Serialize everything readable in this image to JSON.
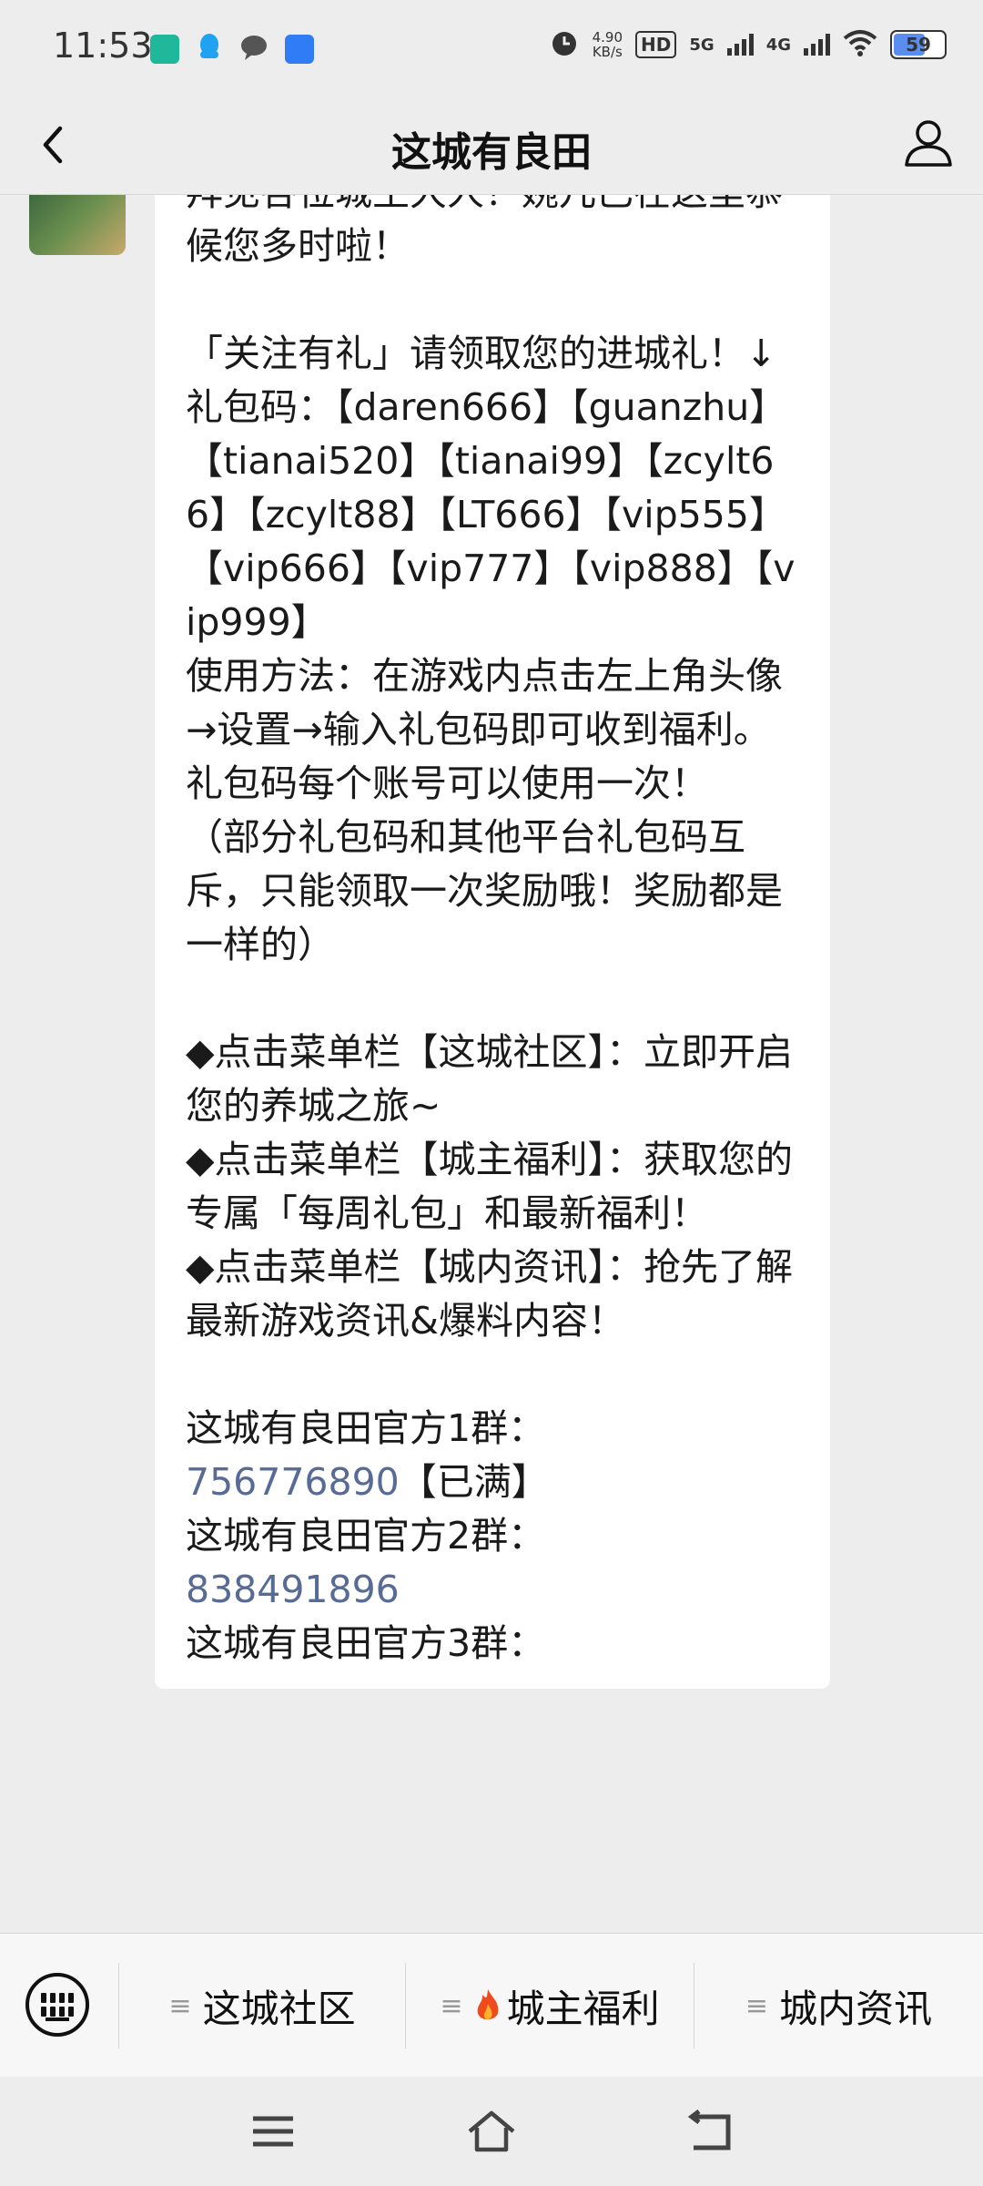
{
  "status": {
    "time": "11:53",
    "speed_value": "4.90",
    "speed_unit": "KB/s",
    "hd": "HD",
    "sim1": "5G",
    "sim2": "4G",
    "battery": "59"
  },
  "header": {
    "title": "这城有良田"
  },
  "message": {
    "lines": [
      "拜见各位城主大人！婉儿已在这里恭候您多时啦！",
      "",
      "「关注有礼」请领取您的进城礼！↓",
      "礼包码：【daren666】【guanzhu】【tianai520】【tianai99】【zcylt66】【zcylt88】【LT666】【vip555】【vip666】【vip777】【vip888】【vip999】",
      "使用方法：在游戏内点击左上角头像→设置→输入礼包码即可收到福利。礼包码每个账号可以使用一次！",
      "（部分礼包码和其他平台礼包码互斥，只能领取一次奖励哦！奖励都是一样的）",
      "",
      "◆点击菜单栏【这城社区】：立即开启您的养城之旅~",
      "◆点击菜单栏【城主福利】：获取您的专属「每周礼包」和最新福利！",
      "◆点击菜单栏【城内资讯】：抢先了解最新游戏资讯&爆料内容！",
      "",
      "这城有良田官方1群："
    ],
    "group1_number": "756776890",
    "group1_status": "【已满】",
    "group2_label": "这城有良田官方2群：",
    "group2_number": "838491896",
    "group3_label": "这城有良田官方3群："
  },
  "menu": {
    "items": [
      {
        "label": "这城社区"
      },
      {
        "label": "城主福利"
      },
      {
        "label": "城内资讯"
      }
    ],
    "hamburger": "≡"
  },
  "colors": {
    "link": "#576b95",
    "background": "#ededed",
    "bubble": "#ffffff"
  },
  "icons": {
    "back": "chevron-left-icon",
    "profile": "user-icon",
    "keyboard": "keyboard-icon",
    "flame": "fire-icon"
  }
}
